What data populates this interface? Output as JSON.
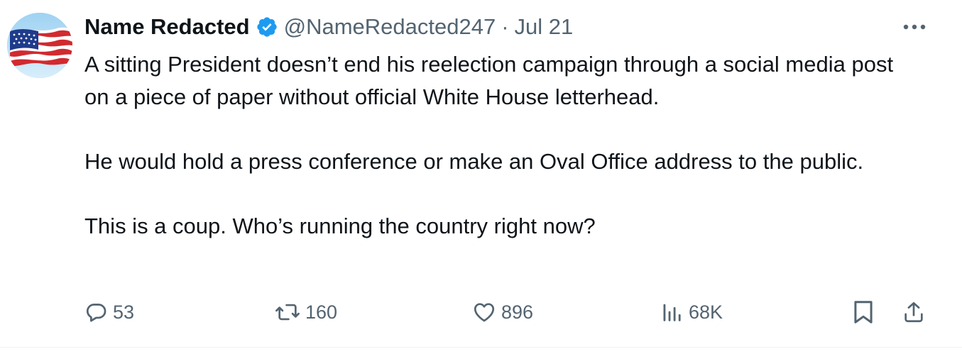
{
  "tweet": {
    "author_name": "Name Redacted",
    "handle": "@NameRedacted247",
    "separator": "·",
    "date": "Jul 21",
    "paragraphs": [
      "A sitting President doesn’t end his reelection campaign through a social media post on a piece of paper without official White House letterhead.",
      "He would hold a press conference or make an Oval Office address to the public.",
      "This is a coup. Who’s running the country right now?"
    ]
  },
  "actions": {
    "replies": "53",
    "reposts": "160",
    "likes": "896",
    "views": "68K"
  },
  "icons": {
    "verified": "verified-badge-icon",
    "more": "more-dots-icon",
    "reply": "reply-bubble-icon",
    "repost": "repost-arrows-icon",
    "like": "heart-icon",
    "views": "views-bars-icon",
    "bookmark": "bookmark-icon",
    "share": "share-upload-icon"
  },
  "colors": {
    "text": "#0f1419",
    "secondary": "#536471",
    "verified": "#1d9bf0"
  }
}
